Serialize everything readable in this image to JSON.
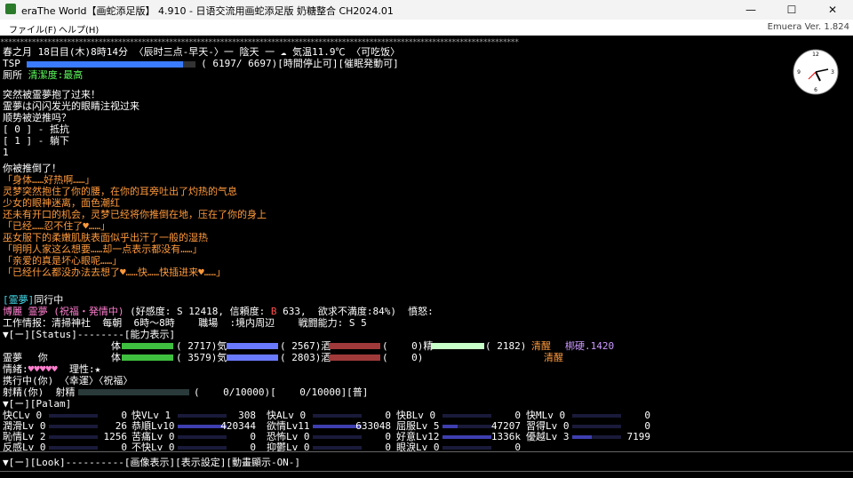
{
  "window": {
    "title": "eraThe World【画蛇添足版】 4.910 - 日语交流用画蛇添足版 奶糖整合 CH2024.01",
    "controls": [
      "—",
      "☐",
      "✕"
    ]
  },
  "menu": {
    "file": "ファイル(F)",
    "help": "ヘルプ(H)",
    "version": "Emuera Ver. 1.824"
  },
  "header": {
    "stars": "************************************************************************************************************************************",
    "datetime_line": "春之月 18日目(木)8時14分 〈辰时三点-早天-〉一 陰天 一",
    "weather_icon": "cloud-icon",
    "temp": "気温11.9℃ 〈可吃饭〉",
    "tsp_label": "TSP",
    "tsp_fraction": 0.93,
    "tsp_value": "( 6197/ 6697)[時間停止可][催眠発動可]",
    "location": "厠所",
    "cleanliness": "清潔度:最高"
  },
  "event": {
    "lines": [
      "突然被霊夢抱了过来！",
      "霊夢は闪闪发光的眼睛注视过来",
      "顺势被逆推吗？",
      "[ 0 ] - 抵抗",
      "[ 1 ] - 躺下",
      "1"
    ]
  },
  "story": {
    "lines": [
      {
        "t": "你被推倒了！",
        "cls": "w"
      },
      {
        "t": "「身体……好热啊……」",
        "cls": "o"
      },
      {
        "t": "灵梦突然抱住了你的腰，在你的耳旁吐出了灼热的气息",
        "cls": "o"
      },
      {
        "t": "少女的眼神迷离，面色潮红",
        "cls": "o"
      },
      {
        "t": "还未有开口的机会，灵梦已经将你推倒在地，压在了你的身上",
        "cls": "o"
      },
      {
        "t": "「已经……忍不住了♥……」",
        "cls": "o"
      },
      {
        "t": "巫女服下的柔嫩肌肤表面似乎出汗了一般的湿热",
        "cls": "o"
      },
      {
        "t": "「明明人家这么想要……却一点表示都没有……」",
        "cls": "o"
      },
      {
        "t": "「亲爱的真是坏心眼呢……」",
        "cls": "o"
      },
      {
        "t": "「已经什么都没办法去想了♥……快……快插进来♥……」",
        "cls": "o"
      }
    ]
  },
  "companion": {
    "line1_a": "[霊夢]",
    "line1_b": "同行中",
    "line2_a": "博麗 霊夢",
    "line2_b": "(祝福・発情中)",
    "line2_c": "(好感度: S 12418, 信頼度:",
    "line2_d": "B",
    "line2_e": " 633,  欲求不満度:84%)  憤怒:",
    "line3": "工作情报：清掃神社  每朝  6時～8時    職場  :境内周辺    戦闘能力: S 5",
    "status_header": "▼[ー][Status]--------[能力表示]",
    "you_label": "你",
    "reimu_label": "霊夢",
    "you_body": "体",
    "you_body_val": "( 2717)気",
    "you_ki_val": "( 2567)酒",
    "you_sake_val": "(    0)精",
    "you_sei_val": "( 2182)",
    "you_state": "清醒",
    "you_extra": "梆硬.1420",
    "reimu_body": "体",
    "reimu_body_val": "( 3579)気",
    "reimu_ki_val": "( 2803)酒",
    "reimu_sake_val": "(    0)",
    "reimu_state": "清醒",
    "mood_label": "情緒:",
    "hearts": "♥♥♥♥♥",
    "reason_label": "理性:",
    "reason_star": "★",
    "carry": "携行中(你) 〈幸運〉〈祝福〉",
    "shasei_a": "射精(你)  射精",
    "shasei_b": "(    0/10000)[    0/10000][普]"
  },
  "palam": {
    "header": "▼[ー][Palam]",
    "rows": [
      [
        {
          "k": "快CLv 0",
          "v": "0",
          "f": 0.0
        },
        {
          "k": "快VLv 1",
          "v": "308",
          "f": 0.0
        },
        {
          "k": "快ALv 0",
          "v": "0",
          "f": 0.0
        },
        {
          "k": "快BLv 0",
          "v": "0",
          "f": 0.0
        },
        {
          "k": "快MLv 0",
          "v": "0",
          "f": 0.0
        }
      ],
      [
        {
          "k": "潤滑Lv 0",
          "v": "26",
          "f": 0.0
        },
        {
          "k": "恭順Lv10",
          "v": "420344",
          "f": 1.0
        },
        {
          "k": "欲情Lv11",
          "v": "633048",
          "f": 1.0
        },
        {
          "k": "屈服Lv 5",
          "v": "47207",
          "f": 0.3
        },
        {
          "k": "習得Lv 0",
          "v": "0",
          "f": 0.0
        }
      ],
      [
        {
          "k": "恥情Lv 2",
          "v": "1256",
          "f": 0.0
        },
        {
          "k": "苦痛Lv 0",
          "v": "0",
          "f": 0.0
        },
        {
          "k": "恐怖Lv 0",
          "v": "0",
          "f": 0.0
        },
        {
          "k": "好意Lv12",
          "v": "1336k",
          "f": 1.0
        },
        {
          "k": "優越Lv 3",
          "v": "7199",
          "f": 0.4
        }
      ],
      [
        {
          "k": "反感Lv 0",
          "v": "0",
          "f": 0.0
        },
        {
          "k": "不快Lv 0",
          "v": "0",
          "f": 0.0
        },
        {
          "k": "抑鬱Lv 0",
          "v": "0",
          "f": 0.0
        },
        {
          "k": "眼淚Lv 0",
          "v": "0",
          "f": 0.0
        }
      ]
    ]
  },
  "footer": {
    "look": "▼[ー][Look]----------[画像表示][表示設定][動畫顯示-ON-]"
  },
  "colors": {
    "tsp_bar": "#3a7bff",
    "hp_bar": "#3fbf3f",
    "ki_bar": "#6a7aff",
    "sake_bar": "#a03a3a",
    "sei_bar": "#c8ffc8",
    "palam_bar": "#3e3eb0"
  }
}
